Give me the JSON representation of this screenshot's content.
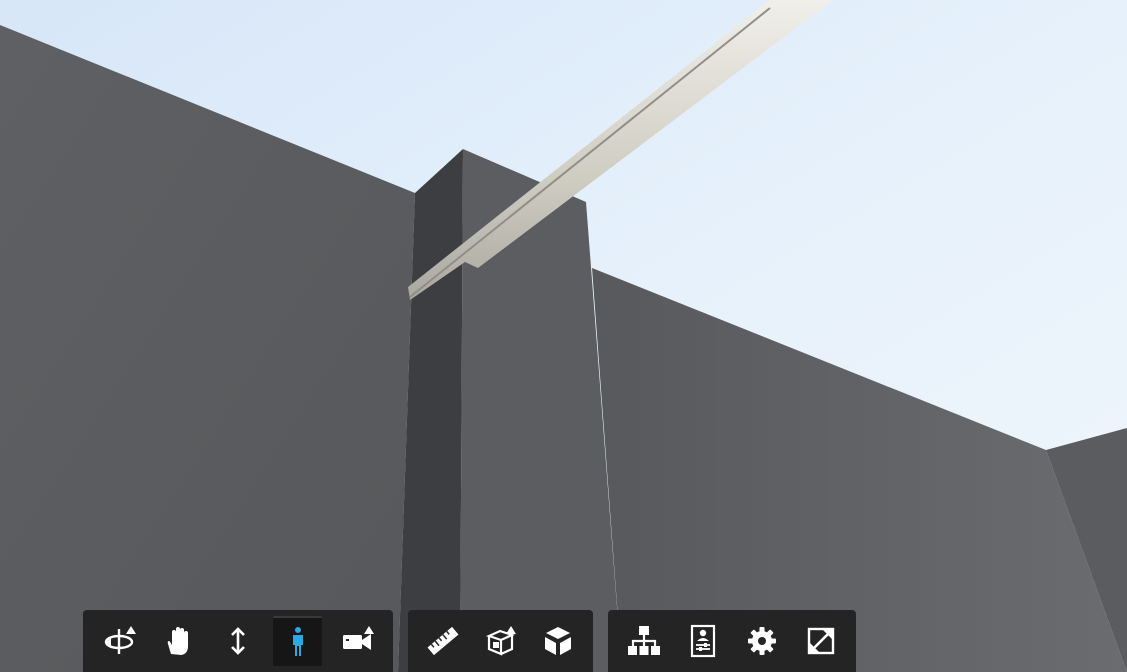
{
  "viewer": {
    "sky_top_color": "#dde9f8",
    "sky_horizon_color": "#eef5fc",
    "wall_color": "#5c5e61",
    "active_tool_color": "#2aa9e6"
  },
  "toolbar": {
    "navigation": [
      {
        "id": "orbit",
        "icon": "orbit-icon",
        "has_submenu": true,
        "active": false
      },
      {
        "id": "pan",
        "icon": "pan-hand-icon",
        "has_submenu": false,
        "active": false
      },
      {
        "id": "zoom",
        "icon": "zoom-vertical-arrows-icon",
        "has_submenu": false,
        "active": false
      },
      {
        "id": "first-person",
        "icon": "person-walk-icon",
        "has_submenu": false,
        "active": true
      },
      {
        "id": "camera",
        "icon": "video-camera-icon",
        "has_submenu": true,
        "active": false
      }
    ],
    "measure": [
      {
        "id": "measure",
        "icon": "ruler-icon",
        "has_submenu": false,
        "active": false
      },
      {
        "id": "section",
        "icon": "section-box-icon",
        "has_submenu": true,
        "active": false
      },
      {
        "id": "explode",
        "icon": "explode-cube-icon",
        "has_submenu": false,
        "active": false
      }
    ],
    "settings": [
      {
        "id": "model-browser",
        "icon": "model-tree-icon",
        "has_submenu": false,
        "active": false
      },
      {
        "id": "properties",
        "icon": "properties-panel-icon",
        "has_submenu": false,
        "active": false
      },
      {
        "id": "settings",
        "icon": "gear-icon",
        "has_submenu": false,
        "active": false
      },
      {
        "id": "fullscreen",
        "icon": "fullscreen-icon",
        "has_submenu": false,
        "active": false
      }
    ]
  }
}
